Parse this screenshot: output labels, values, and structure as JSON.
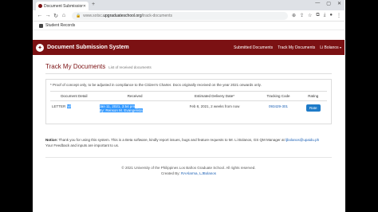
{
  "browser": {
    "tab_title": "Document Submission Sys",
    "tab_close": "✕",
    "new_tab": "+",
    "window_controls": [
      "—",
      "▢",
      "✕"
    ],
    "url_prefix": "www.sotsc.",
    "url_domain": "upgraduateschool.org",
    "url_path": "/track-documents",
    "bookmark_label": "Student Records"
  },
  "site": {
    "brand": "Document Submission System",
    "menu": {
      "submitted": "Submitted Documents",
      "track": "Track My Documents",
      "user": "Li Bolanos"
    }
  },
  "page": {
    "title": "Track My Documents",
    "subtitle": "List of received documents",
    "note": "* Proof of concept only, to be adjusted in compliance to the Citizen's Charter. Docs originally received on the year 2021 onwards only.",
    "columns": [
      "Document Detail",
      "Received",
      "Estimated Delivery Date*",
      "Tracking Code",
      "Rating"
    ],
    "rows": [
      {
        "detail_type": "LETTER",
        "detail_sel": "full",
        "received_date": "Jan 11, 2021, 3:54 pm",
        "received_by": "By: Renson M. Evangelista",
        "delivery": "Feb 8, 2021, 2 weeks from now",
        "tracking": "093429-301",
        "rate_label": "Rate"
      }
    ]
  },
  "notice": {
    "label": "Notice:",
    "text": "Thank you for using this system. This is a Beta software, kindly report issues, bugs and feature requests to Mr. Li Bolanos, GS QM Manager at",
    "email": "ljbolanos@upaidu.ph",
    "line2": "Your Feedback and inputs are important to us."
  },
  "footer": {
    "copyright": "© 2021 University of the Philippines Los Baños Graduate School. All rights reserved.",
    "created_by_label": "Created By:",
    "created_by": "RAAlarma, LJBolanos"
  }
}
